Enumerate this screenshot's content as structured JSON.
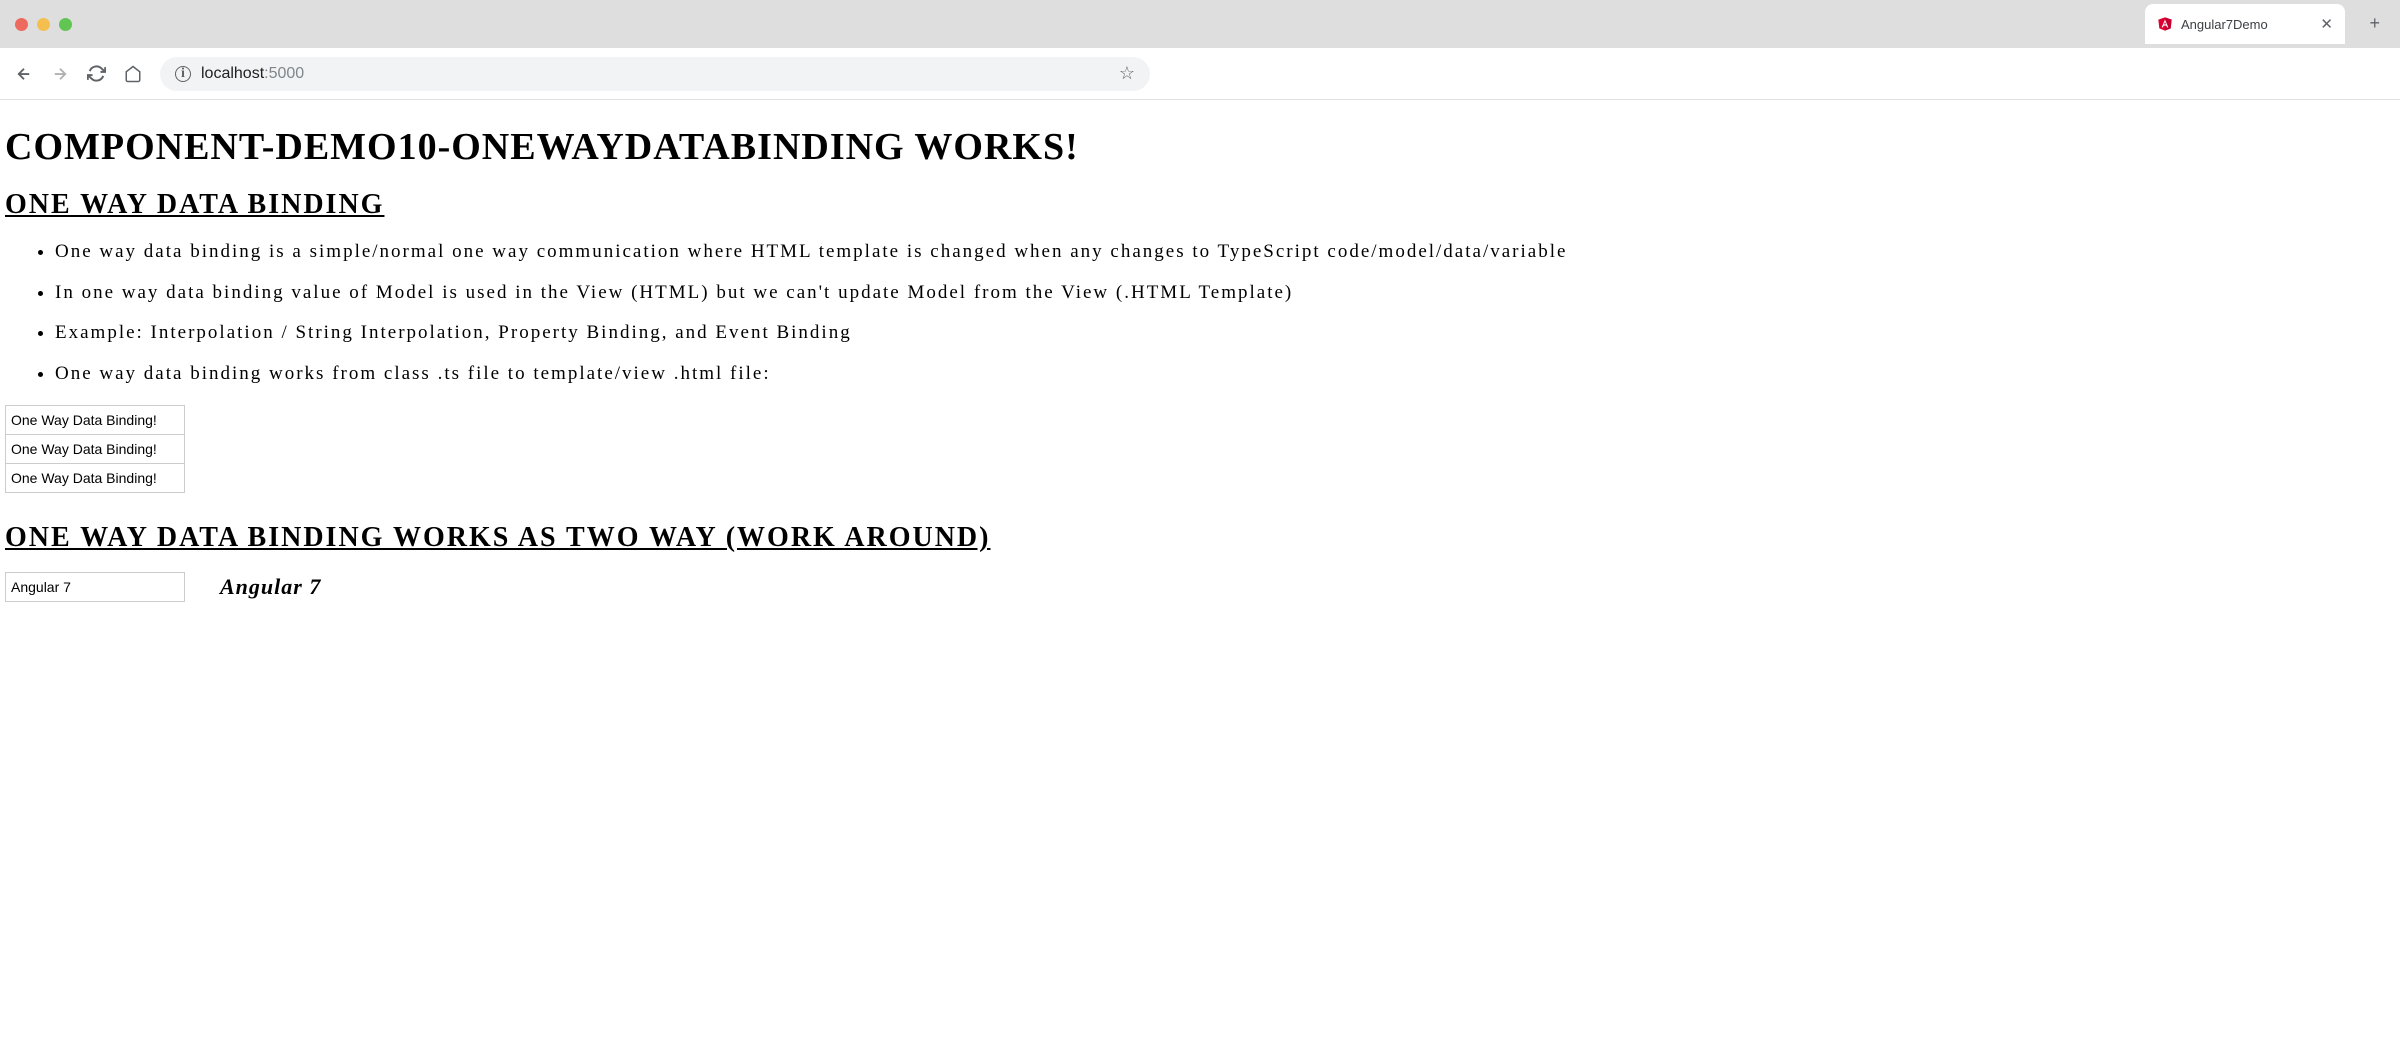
{
  "browser": {
    "tab_title": "Angular7Demo",
    "url_host": "localhost",
    "url_port": ":5000"
  },
  "page": {
    "main_title": "COMPONENT-DEMO10-ONEWAYDATABINDING WORKS!",
    "section1_title": "ONE WAY DATA BINDING",
    "bullets": [
      "One way data binding is a simple/normal one way communication where HTML template is changed when any changes to TypeScript code/model/data/variable",
      "In one way data binding value of Model is used in the View (HTML) but we can't update Model from the View (.HTML Template)",
      "Example: Interpolation / String Interpolation, Property Binding, and Event Binding",
      "One way data binding works from class .ts file to template/view .html file:"
    ],
    "input_values": [
      "One Way Data Binding!",
      "One Way Data Binding!",
      "One Way Data Binding!"
    ],
    "section2_title": "ONE WAY DATA BINDING WORKS AS TWO WAY (WORK AROUND)",
    "twoway_input": "Angular 7",
    "twoway_output": "Angular 7"
  }
}
